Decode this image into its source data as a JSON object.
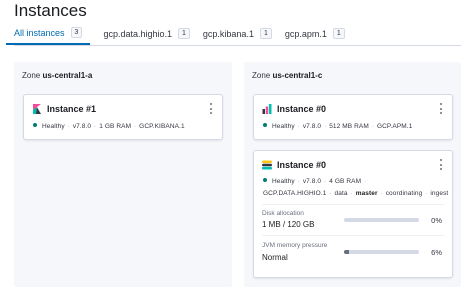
{
  "page": {
    "title": "Instances"
  },
  "tabs": [
    {
      "label": "All instances",
      "count": "3",
      "selected": true
    },
    {
      "label": "gcp.data.highio.1",
      "count": "1",
      "selected": false
    },
    {
      "label": "gcp.kibana.1",
      "count": "1",
      "selected": false
    },
    {
      "label": "gcp.apm.1",
      "count": "1",
      "selected": false
    }
  ],
  "zones": {
    "a": {
      "prefix": "Zone",
      "name": "us-central1-a"
    },
    "c": {
      "prefix": "Zone",
      "name": "us-central1-c"
    }
  },
  "cards": {
    "kibana": {
      "title": "Instance #1",
      "health": "Healthy",
      "version": "v7.8.0",
      "ram": "1 GB RAM",
      "type": "GCP.KIBANA.1"
    },
    "apm": {
      "title": "Instance #0",
      "health": "Healthy",
      "version": "v7.8.0",
      "ram": "512 MB RAM",
      "type": "GCP.APM.1"
    },
    "es": {
      "title": "Instance #0",
      "health": "Healthy",
      "version": "v7.8.0",
      "ram": "4 GB RAM",
      "type": "GCP.DATA.HIGHIO.1",
      "roles": [
        "data",
        "master",
        "coordinating",
        "ingest"
      ],
      "disk": {
        "label": "Disk allocation",
        "value": "1 MB / 120 GB",
        "percent_label": "0%",
        "percent": 0
      },
      "jvm": {
        "label": "JVM memory pressure",
        "value": "Normal",
        "percent_label": "6%",
        "percent": 6
      }
    }
  },
  "colors": {
    "accent": "#006bb4",
    "healthy": "#017d73",
    "zone_bg": "#f5f7fa"
  },
  "icons": {
    "kibana": "kibana-logo-icon",
    "apm": "apm-logo-icon",
    "elasticsearch": "elasticsearch-logo-icon"
  }
}
